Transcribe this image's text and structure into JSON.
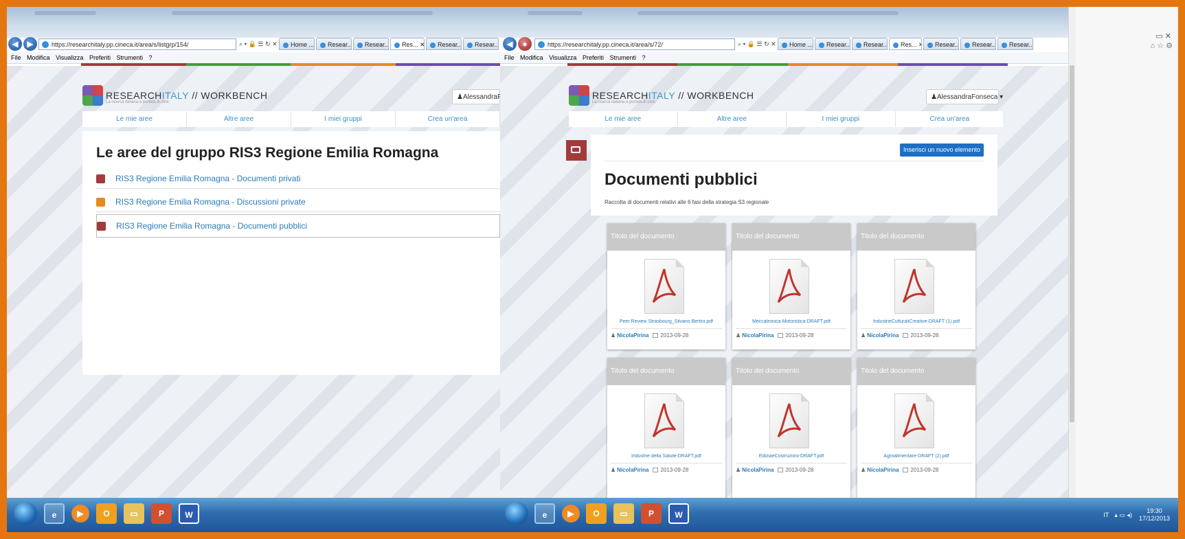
{
  "browser_left": {
    "address": "https://researchitaly.pp.cineca.it/area/s/listgrp/154/",
    "address_icons": "⌕ ▾ 🔒 ☰ ↻ ✕",
    "tabs": [
      "Home ...",
      "Resear...",
      "Resear...",
      "Res...",
      "Resear...",
      "Resear..."
    ],
    "menu": [
      "File",
      "Modifica",
      "Visualizza",
      "Preferiti",
      "Strumenti",
      "?"
    ]
  },
  "browser_right": {
    "address": "https://researchitaly.pp.cineca.it/area/s/72/",
    "address_icons": "⌕ ▾ 🔒 ☰ ↻ ✕",
    "tabs": [
      "Home ...",
      "Resear...",
      "Resear...",
      "Res...",
      "Resear...",
      "Resear...",
      "Resear..."
    ],
    "menu": [
      "File",
      "Modifica",
      "Visualizza",
      "Preferiti",
      "Strumenti",
      "?"
    ]
  },
  "site": {
    "brand_a": "RESEARCH",
    "brand_b": "ITALY",
    "brand_c": " // WORKBENCH",
    "tagline": "La ricerca italiana a portata di click",
    "user_left": "AlessandraFonseca",
    "user_right": "AlessandraFonseca ▾",
    "nav": [
      "Le mie aree",
      "Altre aree",
      "I miei gruppi",
      "Crea un'area"
    ]
  },
  "left_page": {
    "heading": "Le aree del gruppo RIS3 Regione Emilia Romagna",
    "areas": [
      {
        "label": "RIS3 Regione Emilia Romagna - Documenti privati",
        "color": "#a33b3b"
      },
      {
        "label": "RIS3 Regione Emilia Romagna - Discussioni private",
        "color": "#e58a1f"
      },
      {
        "label": "RIS3 Regione Emilia Romagna - Documenti pubblici",
        "color": "#a33b3b"
      }
    ]
  },
  "right_page": {
    "insert_button": "Inserisci un nuovo elemento",
    "heading": "Documenti pubblici",
    "description": "Raccolta di documenti relativi alle 6 fasi della strategia S3 regionale",
    "cards": [
      {
        "title": "Titolo del documento",
        "file": "Peer Review Strasbourg_Silvano Bertini.pdf",
        "author": "NicolaPirina",
        "date": "2013-09-28"
      },
      {
        "title": "Titolo del documento",
        "file": "Meccatronica Motoristica-DRAFT.pdf",
        "author": "NicolaPirina",
        "date": "2013-09-28"
      },
      {
        "title": "Titolo del documento",
        "file": "IndustrieCulturaliCreative-DRAFT (1).pdf",
        "author": "NicolaPirina",
        "date": "2013-09-28"
      },
      {
        "title": "Titolo del documento",
        "file": "Industrie della Salute-DRAFT.pdf",
        "author": "NicolaPirina",
        "date": "2013-09-28"
      },
      {
        "title": "Titolo del documento",
        "file": "EdiziaeCostruzioni-DRAFT.pdf",
        "author": "NicolaPirina",
        "date": "2013-09-28"
      },
      {
        "title": "Titolo del documento",
        "file": "Agroalimentare-DRAFT (2).pdf",
        "author": "NicolaPirina",
        "date": "2013-09-28"
      }
    ]
  },
  "taskbar": {
    "lang": "IT",
    "time": "19:30",
    "date": "17/12/2013"
  },
  "colors": {
    "accent_orange": "#e4760f",
    "link_blue": "#2a7bb8",
    "button_blue": "#1d6fc4",
    "doc_red": "#a33b3b",
    "stripe": [
      "#a33b3b",
      "#4a9a3f",
      "#e58a1f",
      "#6b4ea8"
    ]
  }
}
